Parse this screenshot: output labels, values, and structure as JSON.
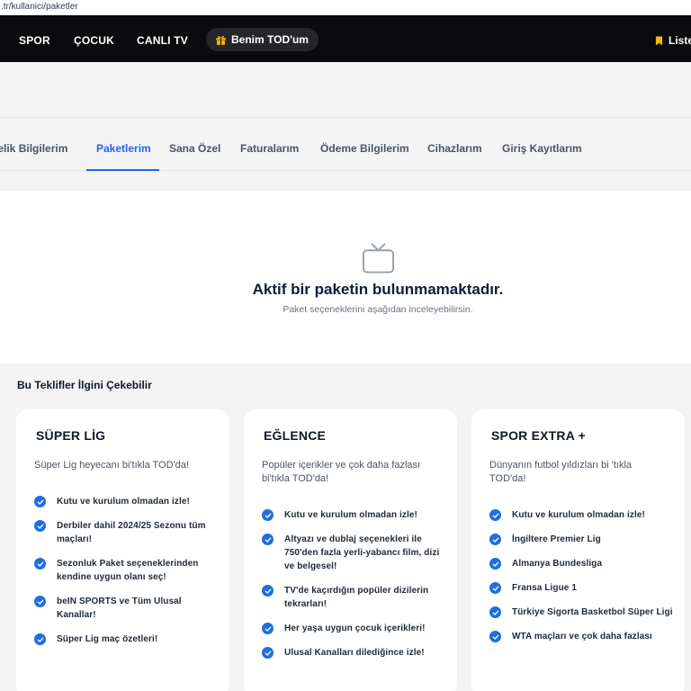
{
  "browser": {
    "url_visible": ".tr/kullanici/paketler"
  },
  "navbar": {
    "items": [
      "SPOR",
      "ÇOCUK",
      "CANLI TV"
    ],
    "benim_label": "Benim TOD'um",
    "liste_label": "Liste",
    "accent_color": "#f5b400",
    "background": "#0b0b0d"
  },
  "tabs": {
    "items": [
      "Üyelik Bilgilerim",
      "Paketlerim",
      "Sana Özel",
      "Faturalarım",
      "Ödeme Bilgilerim",
      "Cihazlarım",
      "Giriş Kayıtlarım"
    ],
    "active": "Paketlerim",
    "active_color": "#2563eb"
  },
  "empty_state": {
    "icon": "tv-icon",
    "title": "Aktif bir paketin bulunmamaktadır.",
    "subtitle": "Paket seçeneklerini aşağıdan inceleyebilirsin."
  },
  "offers": {
    "title": "Bu Teklifler İlgini Çekebilir",
    "cards": [
      {
        "title": "SÜPER LİG",
        "desc": "Süper Lig heyecanı bi'tıkla TOD'da!",
        "features": [
          "Kutu ve kurulum olmadan izle!",
          "Derbiler dahil 2024/25 Sezonu tüm maçları!",
          "Sezonluk Paket seçeneklerinden kendine uygun olanı seç!",
          "beIN SPORTS ve Tüm Ulusal Kanallar!",
          "Süper Lig maç özetleri!"
        ]
      },
      {
        "title": "EĞLENCE",
        "desc": "Popüler içerikler ve çok daha fazlası bi'tıkla TOD'da!",
        "features": [
          "Kutu ve kurulum olmadan izle!",
          "Altyazı ve dublaj seçenekleri ile 750'den fazla yerli-yabancı film, dizi ve belgesel!",
          "TV'de kaçırdığın popüler dizilerin tekrarları!",
          "Her yaşa uygun çocuk içerikleri!",
          "Ulusal Kanalları dilediğince izle!"
        ]
      },
      {
        "title": "SPOR EXTRA +",
        "desc": "Dünyanın futbol yıldızları bi 'tıkla TOD'da!",
        "features": [
          "Kutu ve kurulum olmadan izle!",
          "İngiltere Premier Lig",
          "Almanya Bundesliga",
          "Fransa Ligue 1",
          "Türkiye Sigorta Basketbol Süper Ligi",
          "WTA maçları ve çok daha fazlası"
        ]
      }
    ],
    "check_color": "#1d6fe0"
  }
}
